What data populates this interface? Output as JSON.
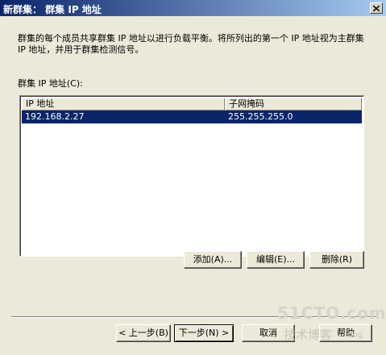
{
  "window": {
    "title": "新群集： 群集 IP 地址"
  },
  "description": "群集的每个成员共享群集 IP 地址以进行负载平衡。将所列出的第一个 IP 地址视为主群集 IP 地址，并用于群集检测信号。",
  "list_label": "群集 IP 地址(C):",
  "table": {
    "columns": [
      "IP 地址",
      "子网掩码"
    ],
    "rows": [
      {
        "ip": "192.168.2.27",
        "mask": "255.255.255.0",
        "selected": true
      }
    ]
  },
  "actions": {
    "add_label": "添加(A)...",
    "edit_label": "编辑(E)...",
    "remove_label": "删除(R)"
  },
  "navigation": {
    "back_label": "< 上一步(B)",
    "next_label": "下一步(N) >",
    "cancel_label": "取消",
    "help_label": "帮助"
  },
  "watermark": {
    "main": "51CTO.com",
    "sub": "技术博客",
    "tag": "Blog"
  },
  "colors": {
    "title_bar": "#0a246a",
    "selection": "#0a246a",
    "dialog_bg": "#ece9d8"
  }
}
